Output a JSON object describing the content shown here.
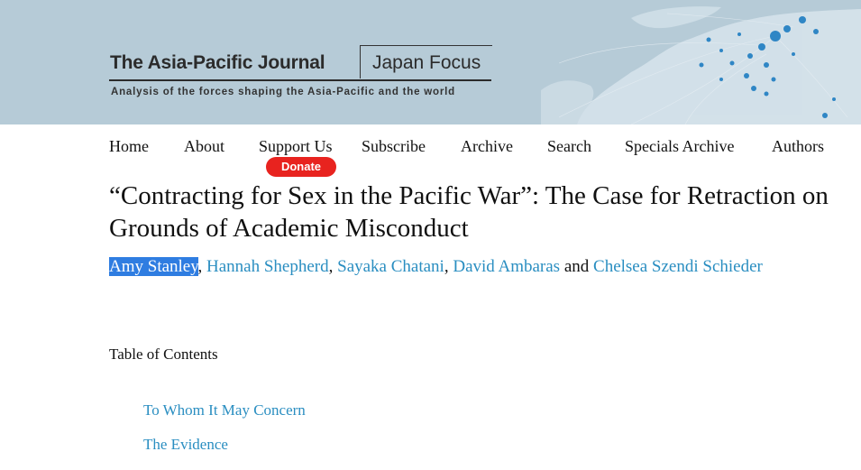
{
  "header": {
    "journal_name": "The Asia-Pacific Journal",
    "journal_subtitle": "Japan Focus",
    "tagline": "Analysis of the forces shaping the Asia-Pacific and the world"
  },
  "nav": {
    "items": [
      {
        "label": "Home"
      },
      {
        "label": "About"
      },
      {
        "label": "Support Us"
      },
      {
        "label": "Subscribe"
      },
      {
        "label": "Archive"
      },
      {
        "label": "Search"
      },
      {
        "label": "Specials Archive"
      },
      {
        "label": "Authors"
      }
    ],
    "donate_label": "Donate"
  },
  "article": {
    "title": "“Contracting for Sex in the Pacific War”: The Case for Retraction on Grounds of Academic Misconduct",
    "authors": [
      {
        "name": "Amy Stanley",
        "selected": true
      },
      {
        "name": "Hannah Shepherd"
      },
      {
        "name": "Sayaka Chatani"
      },
      {
        "name": "David Ambaras"
      },
      {
        "name": "Chelsea Szendi Schieder"
      }
    ],
    "author_separator": ", ",
    "author_conjunction": "and"
  },
  "toc": {
    "heading": "Table of Contents",
    "items": [
      {
        "label": "To Whom It May Concern"
      },
      {
        "label": "The Evidence"
      }
    ]
  },
  "colors": {
    "banner": "#b6cbd7",
    "link": "#2a8ec1",
    "donate": "#e8231f",
    "selection": "#2f7de1"
  }
}
